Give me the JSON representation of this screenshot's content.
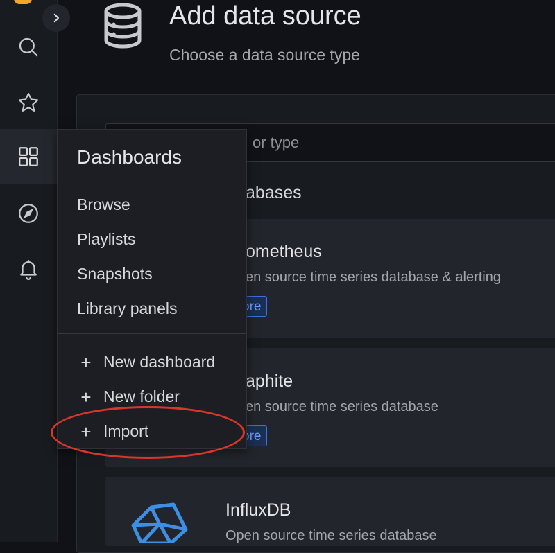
{
  "page": {
    "title": "Add data source",
    "subtitle": "Choose a data source type"
  },
  "search": {
    "placeholder_visible": "or type"
  },
  "section": {
    "title_visible": "abases"
  },
  "datasources": [
    {
      "name": "ometheus",
      "description": "en source time series database & alerting",
      "badge": "ore"
    },
    {
      "name": "aphite",
      "description": "en source time series database",
      "badge": "ore"
    },
    {
      "name": "InfluxDB",
      "description": "Open source time series database"
    }
  ],
  "nav": {
    "items": [
      {
        "id": "search",
        "icon": "search-icon"
      },
      {
        "id": "starred",
        "icon": "star-icon"
      },
      {
        "id": "dashboards",
        "icon": "dashboards-grid-icon",
        "active": true
      },
      {
        "id": "explore",
        "icon": "compass-icon"
      },
      {
        "id": "alerting",
        "icon": "bell-icon"
      }
    ]
  },
  "flyout": {
    "title": "Dashboards",
    "items": [
      "Browse",
      "Playlists",
      "Snapshots",
      "Library panels"
    ],
    "actions": [
      "New dashboard",
      "New folder",
      "Import"
    ]
  },
  "colors": {
    "background": "#111217",
    "panel": "#181b1f",
    "card": "#22252b",
    "accent_blue": "#3d71d9",
    "annotation_red": "#d9352a",
    "logo_orange": "#f5a623"
  }
}
